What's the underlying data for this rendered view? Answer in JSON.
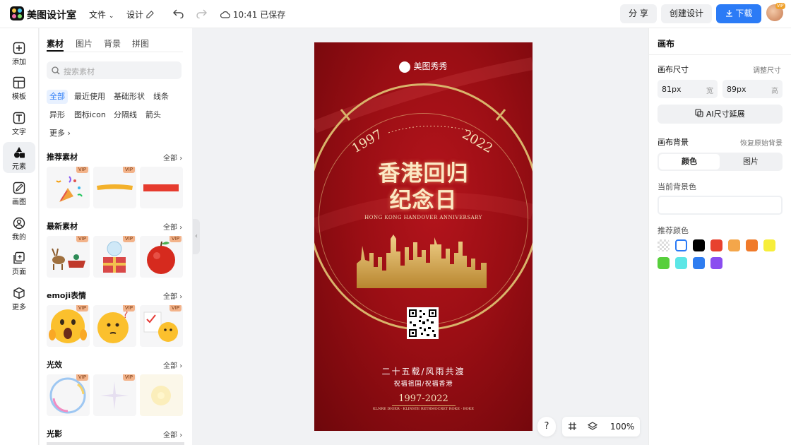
{
  "app": {
    "brand": "美图设计室"
  },
  "topbar": {
    "menu_file": "文件",
    "menu_design": "设计",
    "save_status": "10:41 已保存",
    "share_label": "分 享",
    "create_label": "创建设计",
    "download_label": "下载",
    "vip_badge": "VIP"
  },
  "rail": {
    "items": [
      {
        "label": "添加"
      },
      {
        "label": "模板"
      },
      {
        "label": "文字"
      },
      {
        "label": "元素"
      },
      {
        "label": "画图"
      },
      {
        "label": "我的"
      },
      {
        "label": "页面"
      },
      {
        "label": "更多"
      }
    ]
  },
  "panel": {
    "tabs": [
      "素材",
      "图片",
      "背景",
      "拼图"
    ],
    "search_placeholder": "搜索素材",
    "chips": [
      "全部",
      "最近使用",
      "基础形状",
      "线条",
      "异形",
      "图标icon",
      "分隔线",
      "箭头",
      "更多"
    ],
    "sections": [
      {
        "title": "推荐素材",
        "all": "全部"
      },
      {
        "title": "最新素材",
        "all": "全部"
      },
      {
        "title": "emoji表情",
        "all": "全部"
      },
      {
        "title": "光效",
        "all": "全部"
      },
      {
        "title": "光影",
        "all": "全部"
      }
    ],
    "vip": "VIP"
  },
  "poster": {
    "brand": "美图秀秀",
    "year_left": "1997",
    "year_right": "2022",
    "title_line1": "香港回归",
    "title_line2": "纪念日",
    "subtitle_en": "HONG KONG HANDOVER ANNIVERSARY",
    "line1": "二十五载/风雨共渡",
    "line2": "祝福祖国/祝福香港",
    "years_range": "1997-2022",
    "footer_small": "KLNRE DIOXR · KLINSTE RETRMOCRET ROKE · BOKE"
  },
  "floatbar": {
    "help": "?",
    "zoom": "100%"
  },
  "right_panel": {
    "title": "画布",
    "size_label": "画布尺寸",
    "resize_link": "调整尺寸",
    "width_value": "81px",
    "width_unit": "宽",
    "height_value": "89px",
    "height_unit": "高",
    "ai_extend": "AI尺寸延展",
    "bg_label": "画布背景",
    "restore_link": "恢复原始背景",
    "seg_color": "颜色",
    "seg_image": "图片",
    "current_bg_label": "当前背景色",
    "recommended_label": "推荐颜色",
    "swatches": [
      "transparent",
      "#ffffff",
      "#000000",
      "#e8412e",
      "#f4a64a",
      "#f07a2a",
      "#f7ee3a",
      "#57cf3c",
      "#5ce6e6",
      "#2f7df0",
      "#8a4df0"
    ]
  }
}
